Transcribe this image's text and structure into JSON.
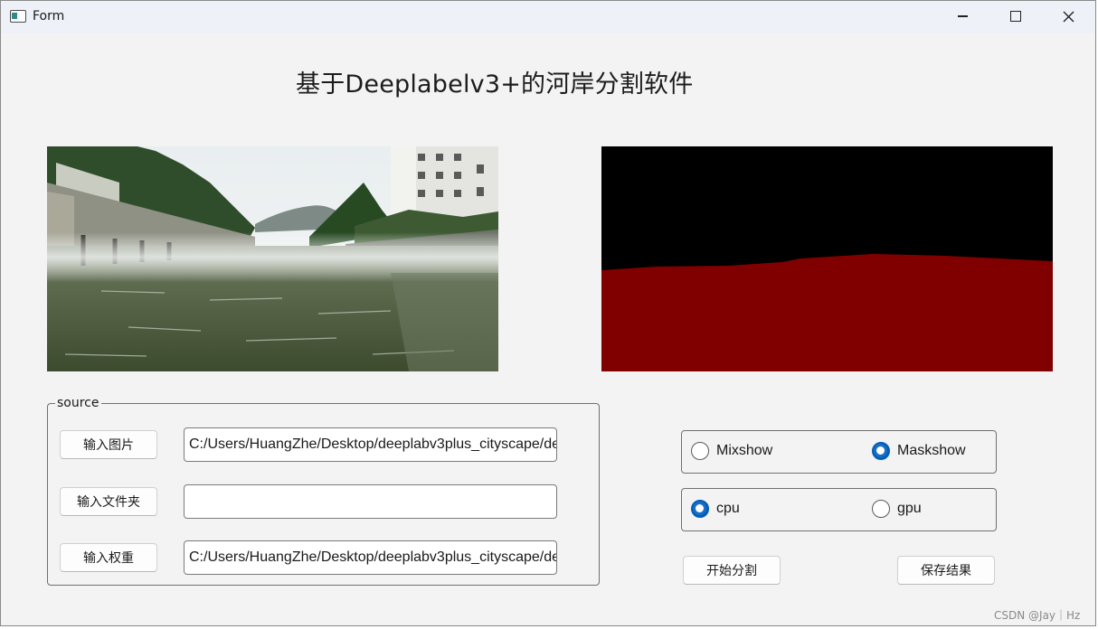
{
  "window": {
    "title": "Form",
    "icon": "app-window-icon",
    "controls": {
      "minimize": "minimize-icon",
      "maximize": "maximize-icon",
      "close": "close-icon"
    }
  },
  "page_title": "基于Deeplabelv3+的河岸分割软件",
  "images": {
    "source": "river-bank-photo",
    "mask": "segmentation-mask"
  },
  "source_group": {
    "label": "source",
    "rows": [
      {
        "button": "输入图片",
        "value": "C:/Users/HuangZhe/Desktop/deeplabv3plus_cityscape/de"
      },
      {
        "button": "输入文件夹",
        "value": ""
      },
      {
        "button": "输入权重",
        "value": "C:/Users/HuangZhe/Desktop/deeplabv3plus_cityscape/de"
      }
    ]
  },
  "display_mode": {
    "options": [
      {
        "label": "Mixshow",
        "checked": false
      },
      {
        "label": "Maskshow",
        "checked": true
      }
    ]
  },
  "device": {
    "options": [
      {
        "label": "cpu",
        "checked": true
      },
      {
        "label": "gpu",
        "checked": false
      }
    ]
  },
  "actions": {
    "start": "开始分割",
    "save": "保存结果"
  },
  "watermark": "CSDN @Jay｜Hz",
  "colors": {
    "mask_background": "#000000",
    "mask_river": "#800000",
    "radio_checked": "#005fb8",
    "window_bg": "#f3f3f3"
  }
}
